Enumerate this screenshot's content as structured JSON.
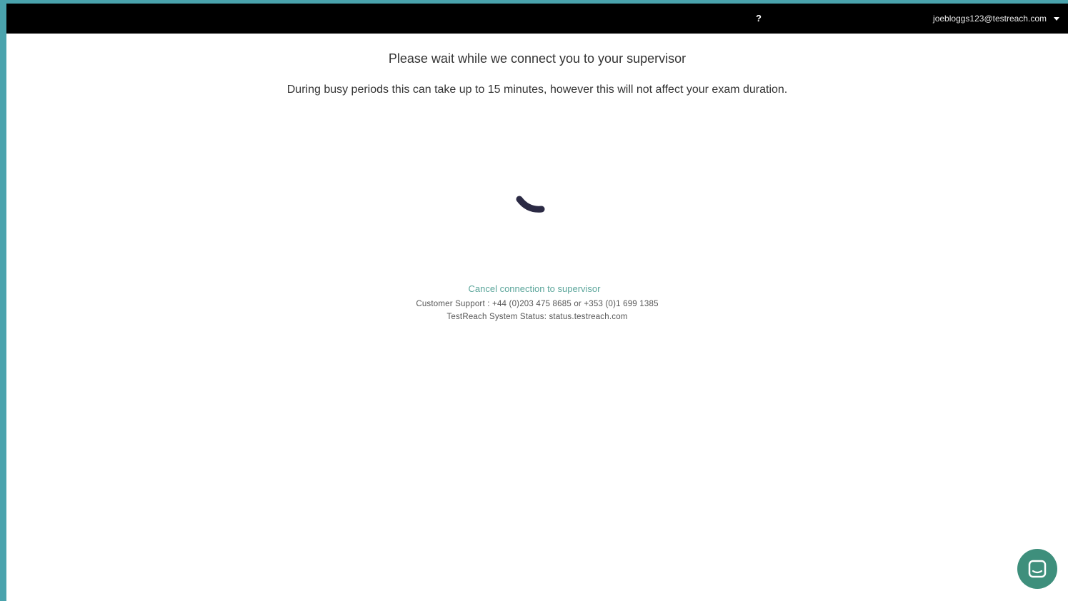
{
  "header": {
    "help_label": "?",
    "user_email": "joebloggs123@testreach.com"
  },
  "main": {
    "title": "Please wait while we connect you to your supervisor",
    "subtitle": "During busy periods this can take up to 15 minutes, however this will not affect your exam duration.",
    "cancel_link": "Cancel connection to supervisor",
    "support_text": "Customer Support : +44 (0)203 475 8685 or +353 (0)1 699 1385",
    "status_text": "TestReach System Status: status.testreach.com"
  },
  "icons": {
    "spinner": "loading-spinner-icon",
    "chat": "chat-icon",
    "user_menu_caret": "caret-down-icon"
  },
  "colors": {
    "frame_border": "#4aa3ad",
    "topbar": "#000000",
    "link": "#5aa59a",
    "chat_button": "#3e8f7c",
    "spinner": "#2b2a44"
  }
}
